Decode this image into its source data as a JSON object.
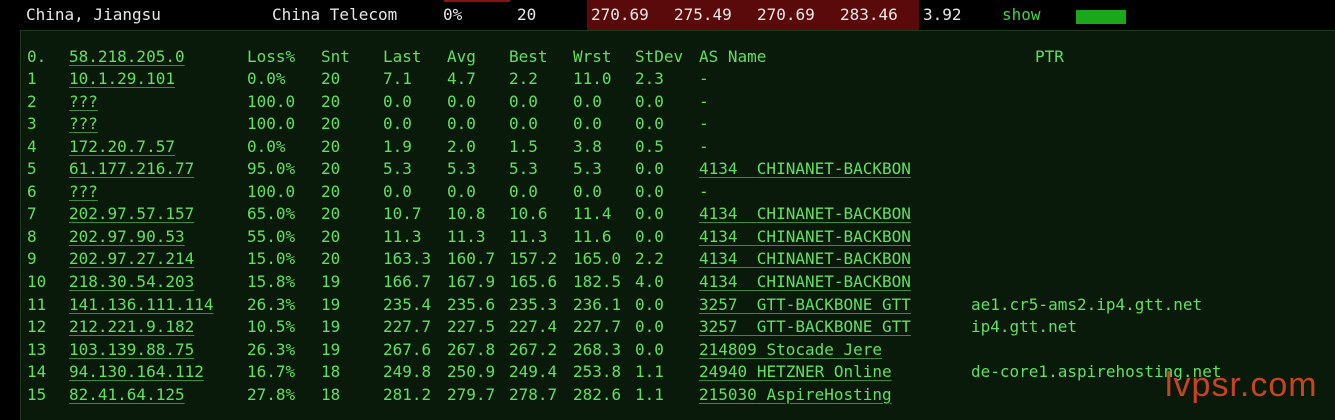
{
  "summary": {
    "location": "China, Jiangsu",
    "isp": "China Telecom",
    "loss": "0%",
    "sent": "20",
    "last": "270.69",
    "avg": "275.49",
    "best": "270.69",
    "worst": "283.46",
    "stdev": "3.92",
    "show_label": "show"
  },
  "headers": {
    "host": "58.218.205.0",
    "index": "0.",
    "loss": "Loss%",
    "snt": "Snt",
    "last": "Last",
    "avg": "Avg",
    "best": "Best",
    "wrst": "Wrst",
    "stdev": "StDev",
    "asname": "AS Name",
    "ptr": "PTR"
  },
  "hops": [
    {
      "n": "1",
      "host": "10.1.29.101",
      "loss": "0.0%",
      "snt": "20",
      "last": "7.1",
      "avg": "4.7",
      "best": "2.2",
      "wrst": "11.0",
      "stdev": "2.3",
      "asn": "",
      "asname": "-",
      "ptr": ""
    },
    {
      "n": "2",
      "host": "???",
      "loss": "100.0",
      "snt": "20",
      "last": "0.0",
      "avg": "0.0",
      "best": "0.0",
      "wrst": "0.0",
      "stdev": "0.0",
      "asn": "",
      "asname": "-",
      "ptr": ""
    },
    {
      "n": "3",
      "host": "???",
      "loss": "100.0",
      "snt": "20",
      "last": "0.0",
      "avg": "0.0",
      "best": "0.0",
      "wrst": "0.0",
      "stdev": "0.0",
      "asn": "",
      "asname": "-",
      "ptr": ""
    },
    {
      "n": "4",
      "host": "172.20.7.57",
      "loss": "0.0%",
      "snt": "20",
      "last": "1.9",
      "avg": "2.0",
      "best": "1.5",
      "wrst": "3.8",
      "stdev": "0.5",
      "asn": "",
      "asname": "-",
      "ptr": ""
    },
    {
      "n": "5",
      "host": "61.177.216.77",
      "loss": "95.0%",
      "snt": "20",
      "last": "5.3",
      "avg": "5.3",
      "best": "5.3",
      "wrst": "5.3",
      "stdev": "0.0",
      "asn": "4134",
      "asname": "CHINANET-BACKBON",
      "ptr": ""
    },
    {
      "n": "6",
      "host": "???",
      "loss": "100.0",
      "snt": "20",
      "last": "0.0",
      "avg": "0.0",
      "best": "0.0",
      "wrst": "0.0",
      "stdev": "0.0",
      "asn": "",
      "asname": "-",
      "ptr": ""
    },
    {
      "n": "7",
      "host": "202.97.57.157",
      "loss": "65.0%",
      "snt": "20",
      "last": "10.7",
      "avg": "10.8",
      "best": "10.6",
      "wrst": "11.4",
      "stdev": "0.0",
      "asn": "4134",
      "asname": "CHINANET-BACKBON",
      "ptr": ""
    },
    {
      "n": "8",
      "host": "202.97.90.53",
      "loss": "55.0%",
      "snt": "20",
      "last": "11.3",
      "avg": "11.3",
      "best": "11.3",
      "wrst": "11.6",
      "stdev": "0.0",
      "asn": "4134",
      "asname": "CHINANET-BACKBON",
      "ptr": ""
    },
    {
      "n": "9",
      "host": "202.97.27.214",
      "loss": "15.0%",
      "snt": "20",
      "last": "163.3",
      "avg": "160.7",
      "best": "157.2",
      "wrst": "165.0",
      "stdev": "2.2",
      "asn": "4134",
      "asname": "CHINANET-BACKBON",
      "ptr": ""
    },
    {
      "n": "10",
      "host": "218.30.54.203",
      "loss": "15.8%",
      "snt": "19",
      "last": "166.7",
      "avg": "167.9",
      "best": "165.6",
      "wrst": "182.5",
      "stdev": "4.0",
      "asn": "4134",
      "asname": "CHINANET-BACKBON",
      "ptr": ""
    },
    {
      "n": "11",
      "host": "141.136.111.114",
      "loss": "26.3%",
      "snt": "19",
      "last": "235.4",
      "avg": "235.6",
      "best": "235.3",
      "wrst": "236.1",
      "stdev": "0.0",
      "asn": "3257",
      "asname": "GTT-BACKBONE GTT",
      "ptr": "ae1.cr5-ams2.ip4.gtt.net"
    },
    {
      "n": "12",
      "host": "212.221.9.182",
      "loss": "10.5%",
      "snt": "19",
      "last": "227.7",
      "avg": "227.5",
      "best": "227.4",
      "wrst": "227.7",
      "stdev": "0.0",
      "asn": "3257",
      "asname": "GTT-BACKBONE GTT",
      "ptr": "ip4.gtt.net"
    },
    {
      "n": "13",
      "host": "103.139.88.75",
      "loss": "26.3%",
      "snt": "19",
      "last": "267.6",
      "avg": "267.8",
      "best": "267.2",
      "wrst": "268.3",
      "stdev": "0.0",
      "asn": "214809",
      "asname": "Stocade Jere",
      "ptr": ""
    },
    {
      "n": "14",
      "host": "94.130.164.112",
      "loss": "16.7%",
      "snt": "18",
      "last": "249.8",
      "avg": "250.9",
      "best": "249.4",
      "wrst": "253.8",
      "stdev": "1.1",
      "asn": "24940",
      "asname": "HETZNER Online",
      "ptr": "de-core1.aspirehosting.net"
    },
    {
      "n": "15",
      "host": "82.41.64.125",
      "loss": "27.8%",
      "snt": "18",
      "last": "281.2",
      "avg": "279.7",
      "best": "278.7",
      "wrst": "282.6",
      "stdev": "1.1",
      "asn": "215030",
      "asname": "AspireHosting",
      "ptr": ""
    }
  ],
  "watermark": "lvpsr.com",
  "colors": {
    "text_green": "#5fe05f",
    "panel_bg": "#0a1a0a",
    "highlight_red": "#5a0a0a",
    "bar_green": "#1aa81a",
    "watermark": "#c8441f"
  }
}
